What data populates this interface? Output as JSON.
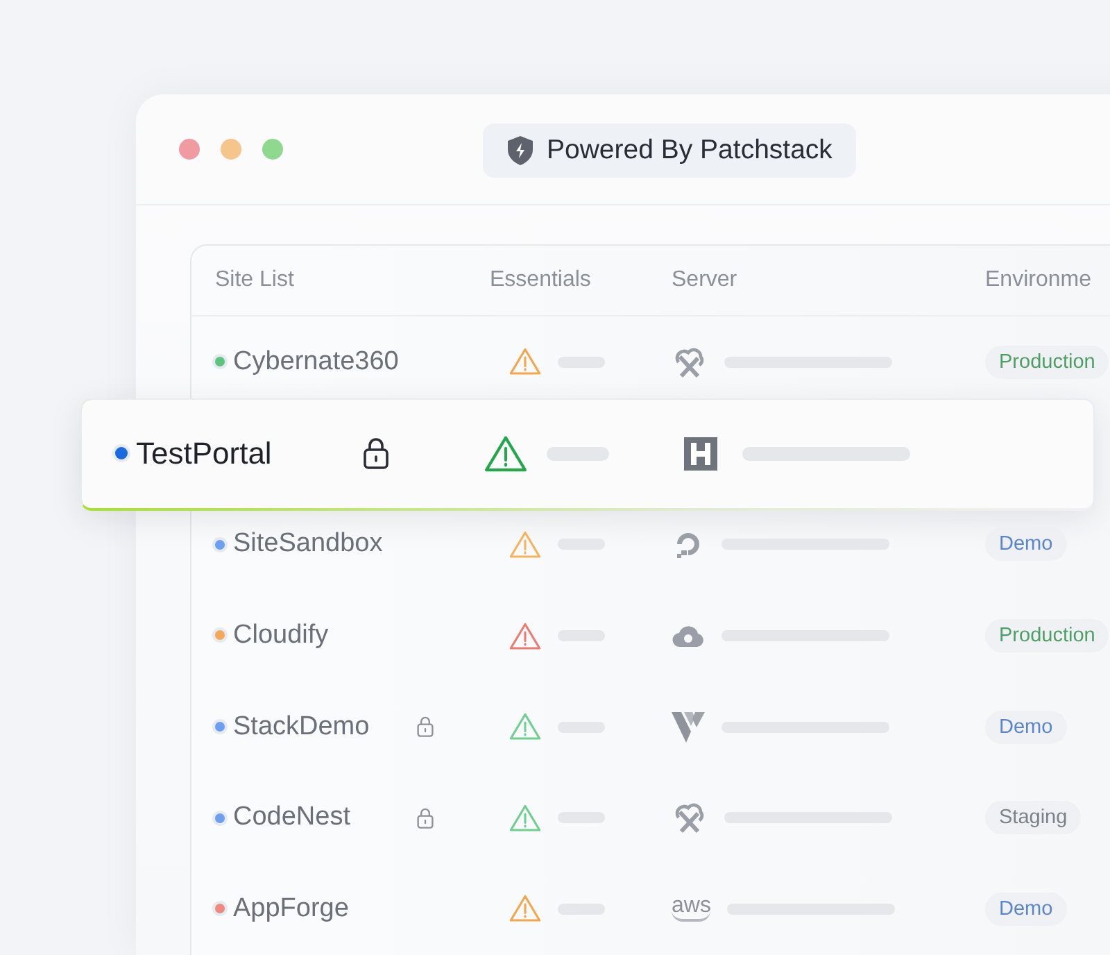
{
  "window": {
    "controls": [
      {
        "color": "#ef9ba0"
      },
      {
        "color": "#f5c58c"
      },
      {
        "color": "#8fd98f"
      }
    ],
    "badge": "Powered By Patchstack"
  },
  "table": {
    "columns": [
      "Site List",
      "Essentials",
      "Server",
      "Environme"
    ],
    "rows": [
      {
        "name": "Cybernate360",
        "color": "#5cc47c",
        "selected": false,
        "locked": false,
        "essentials": {
          "color": "#f5a54a"
        },
        "server": {
          "kind": "cloud-x"
        },
        "environment": {
          "label": "Production",
          "kind": "production"
        }
      },
      {
        "name": "TestPortal",
        "color": "#1a6be0",
        "selected": true,
        "locked": true,
        "essentials": {
          "color": "#22a84a"
        },
        "server": {
          "kind": "h"
        }
      },
      {
        "name": "SiteSandbox",
        "color": "#6b9ff0",
        "selected": false,
        "locked": false,
        "essentials": {
          "color": "#f5b35e"
        },
        "server": {
          "kind": "ring"
        },
        "environment": {
          "label": "Demo",
          "kind": "demo"
        }
      },
      {
        "name": "Cloudify",
        "color": "#f4a85c",
        "selected": false,
        "locked": false,
        "essentials": {
          "color": "#ec7b72"
        },
        "server": {
          "kind": "cloud"
        },
        "environment": {
          "label": "Production",
          "kind": "production"
        }
      },
      {
        "name": "StackDemo",
        "color": "#6b9ff0",
        "selected": false,
        "locked": true,
        "essentials": {
          "color": "#6fcf8f"
        },
        "server": {
          "kind": "v"
        },
        "environment": {
          "label": "Demo",
          "kind": "demo"
        }
      },
      {
        "name": "CodeNest",
        "color": "#6b9ff0",
        "selected": false,
        "locked": true,
        "essentials": {
          "color": "#6fcf8f"
        },
        "server": {
          "kind": "cloud-x"
        },
        "environment": {
          "label": "Staging",
          "kind": "staging"
        }
      },
      {
        "name": "AppForge",
        "color": "#ef8a80",
        "selected": false,
        "locked": false,
        "essentials": {
          "color": "#f5a54a"
        },
        "server": {
          "kind": "wordmark",
          "label": "aws"
        },
        "environment": {
          "label": "Demo",
          "kind": "demo"
        }
      }
    ]
  }
}
